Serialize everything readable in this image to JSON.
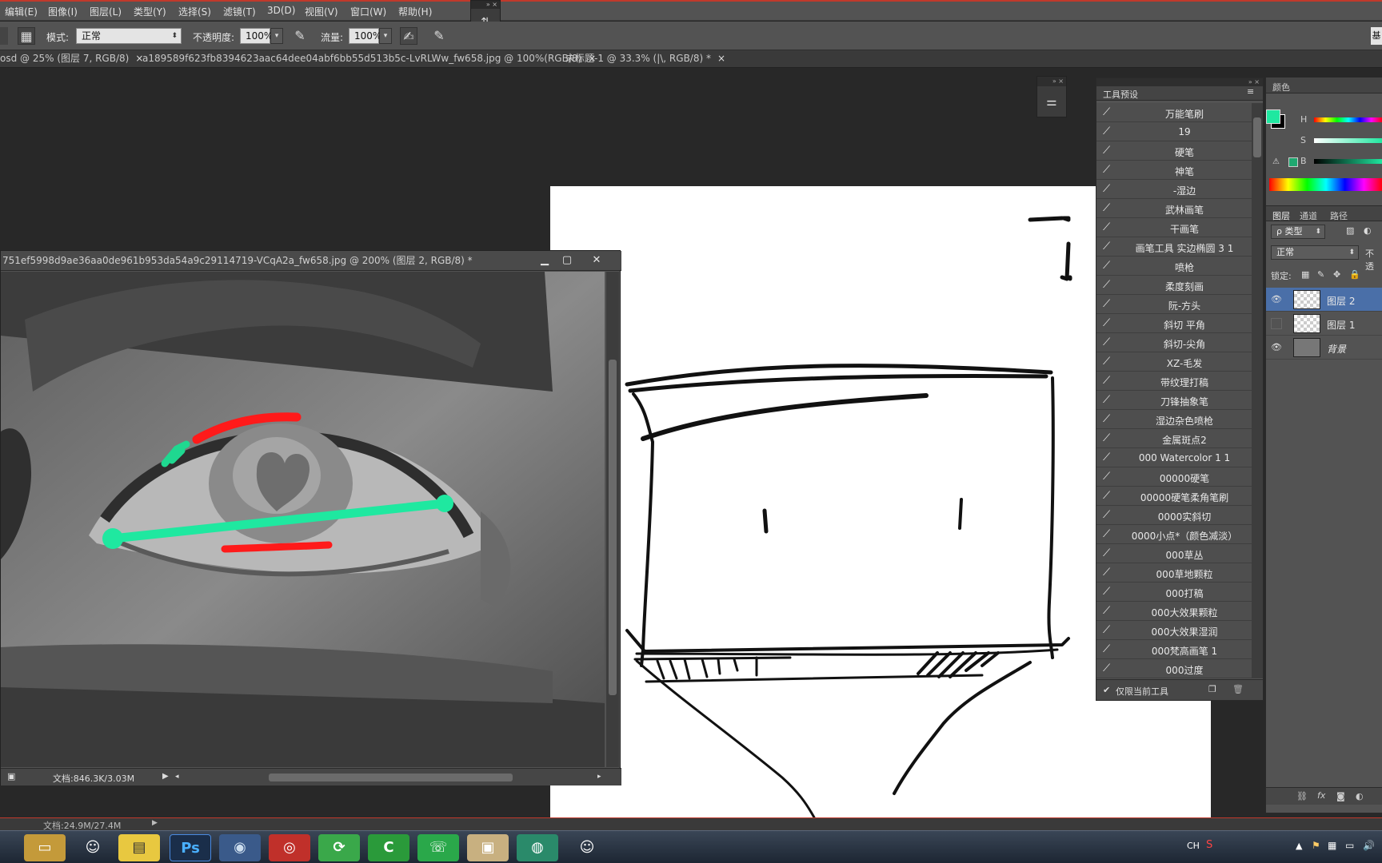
{
  "menubar": {
    "items": [
      "编辑(E)",
      "图像(I)",
      "图层(L)",
      "类型(Y)",
      "选择(S)",
      "滤镜(T)",
      "3D(D)",
      "视图(V)",
      "窗口(W)",
      "帮助(H)"
    ]
  },
  "options": {
    "mode_label": "模式:",
    "mode_value": "正常",
    "opacity_label": "不透明度:",
    "opacity_value": "100%",
    "flow_label": "流量:",
    "flow_value": "100%"
  },
  "tabs": [
    "osd @ 25% (图层 7, RGB/8)",
    "a189589f623fb8394623aac64dee04abf6bb55d513b5c-LvRLWw_fw658.jpg @ 100%(RGB/8)",
    "未标题-1 @ 33.3% (|\\, RGB/8) *"
  ],
  "tab_close_glyph": "×",
  "docwin": {
    "title": "751ef5998d9ae36aa0de961b953da54a9c29114719-VCqA2a_fw658.jpg @ 200% (图层 2, RGB/8) *",
    "status": "文档:846.3K/3.03M"
  },
  "presets": {
    "panel_title": "工具预设",
    "items": [
      "万能笔刷",
      "19",
      "硬笔",
      "神笔",
      "-湿边",
      "武林画笔",
      "干画笔",
      "画笔工具 实边椭圆 3 1",
      "喷枪",
      "柔度刻画",
      "阮-方头",
      "斜切 平角",
      "斜切-尖角",
      "XZ-毛发",
      "带纹理打稿",
      "刀锋抽象笔",
      "湿边杂色喷枪",
      "金属斑点2",
      "000 Watercolor 1 1",
      "00000硬笔",
      "00000硬笔柔角笔刷",
      "0000实斜切",
      "0000小点*（颜色减淡）",
      "000草丛",
      "000草地颗粒",
      "000打稿",
      "000大效果颗粒",
      "000大效果湿润",
      "000梵高画笔 1",
      "000过度"
    ],
    "current_tool_only": "仅限当前工具"
  },
  "color_panel": {
    "title": "颜色",
    "h_label": "H",
    "s_label": "S",
    "b_label": "B",
    "foreground": "#1fe8a0",
    "background": "#000000"
  },
  "layers_panel": {
    "tabs": [
      "图层",
      "通道",
      "路径"
    ],
    "filter_label": "ρ 类型",
    "blend_mode": "正常",
    "opacity_label": "不透",
    "lock_label": "锁定:",
    "layers": [
      {
        "name": "图层 2",
        "visible": true,
        "selected": true
      },
      {
        "name": "图层 1",
        "visible": false,
        "selected": false
      },
      {
        "name": "背景",
        "visible": true,
        "selected": false
      }
    ]
  },
  "main_status": "文档:24.9M/27.4M",
  "taskbar": {
    "apps": [
      "folder",
      "qq",
      "notepad",
      "Ps",
      "browser",
      "netease-music",
      "360",
      "camtasia",
      "wechat",
      "photo",
      "app",
      "qq-2"
    ],
    "tray_text": "CH"
  }
}
